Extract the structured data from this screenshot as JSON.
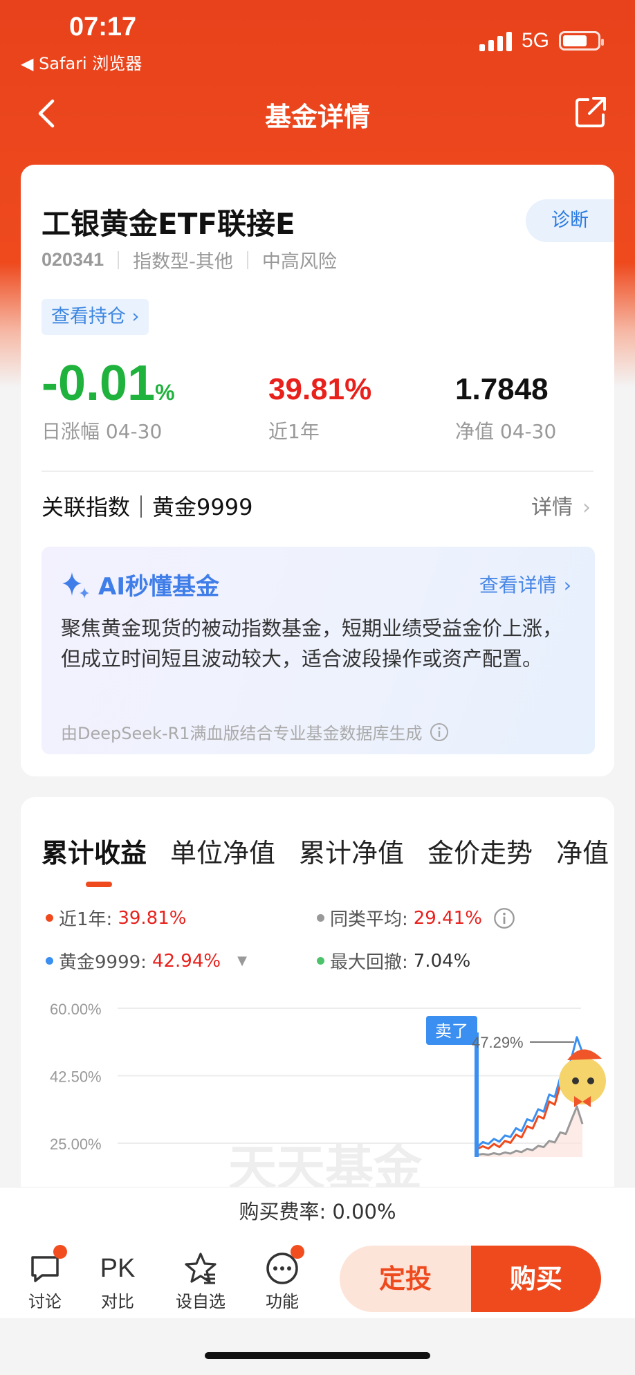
{
  "status_bar": {
    "time": "07:17",
    "back_app": "◀ Safari 浏览器",
    "network": "5G"
  },
  "nav": {
    "title": "基金详情"
  },
  "fund": {
    "name": "工银黄金ETF联接E",
    "diagnose_label": "诊断",
    "code": "020341",
    "type": "指数型-其他",
    "risk": "中高风险",
    "holdings_label": "查看持仓 ›",
    "daily_change": "-0.01",
    "daily_change_unit": "%",
    "daily_change_label": "日涨幅 04-30",
    "year_return": "39.81%",
    "year_return_label": "近1年",
    "nav_value": "1.7848",
    "nav_label": "净值 04-30"
  },
  "index": {
    "label": "关联指数｜黄金9999",
    "detail": "详情"
  },
  "ai": {
    "title": "AI秒懂基金",
    "more": "查看详情",
    "text": "聚焦黄金现货的被动指数基金，短期业绩受益金价上涨，但成立时间短且波动较大，适合波段操作或资产配置。",
    "source": "由DeepSeek-R1满血版结合专业基金数据库生成"
  },
  "tabs": [
    "累计收益",
    "单位净值",
    "累计净值",
    "金价走势",
    "净值"
  ],
  "legend": {
    "year_label": "近1年:",
    "year_value": "39.81%",
    "avg_label": "同类平均:",
    "avg_value": "29.41%",
    "gold_label": "黄金9999:",
    "gold_value": "42.94%",
    "drawdown_label": "最大回撤:",
    "drawdown_value": "7.04%"
  },
  "colors": {
    "fund": "#f04a1c",
    "gold": "#3a8ff0",
    "avg": "#999999",
    "drawdown": "#4cc36a"
  },
  "chart_data": {
    "type": "line",
    "y_ticks": [
      "60.00%",
      "42.50%",
      "25.00%"
    ],
    "ylim": [
      25,
      60
    ],
    "sell_marker": "卖了",
    "peak_label": "47.29%",
    "series": [
      {
        "name": "近1年",
        "values": [
          23.5,
          24.2,
          23.6,
          24.8,
          24.0,
          25.6,
          25.1,
          27.2,
          26.5,
          29.4,
          28.8,
          32.0,
          31.4,
          35.8,
          35.0,
          40.2,
          39.6,
          45.5,
          47.29,
          44.0
        ]
      },
      {
        "name": "黄金9999",
        "values": [
          24.0,
          25.3,
          24.8,
          26.1,
          25.4,
          27.0,
          26.6,
          28.9,
          28.1,
          31.2,
          30.7,
          33.8,
          33.2,
          37.6,
          37.0,
          42.1,
          41.5,
          47.0,
          52.5,
          48.5
        ]
      },
      {
        "name": "同类平均",
        "values": [
          22.0,
          22.2,
          22.0,
          22.4,
          22.1,
          22.6,
          22.3,
          23.0,
          22.7,
          23.5,
          23.2,
          24.3,
          24.0,
          25.6,
          25.2,
          27.8,
          27.4,
          31.0,
          34.5,
          30.0
        ]
      }
    ]
  },
  "watermark": "天天基金",
  "footer": {
    "fee": "购买费率: 0.00%",
    "discuss": "讨论",
    "pk_icon": "PK",
    "pk": "对比",
    "watchlist": "设自选",
    "more": "功能",
    "sip": "定投",
    "buy": "购买"
  }
}
